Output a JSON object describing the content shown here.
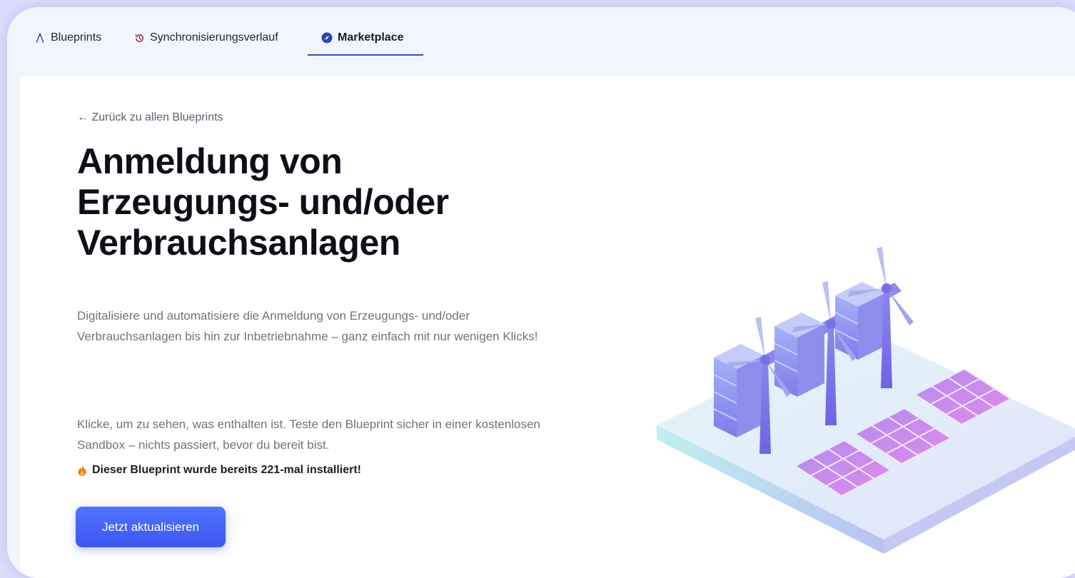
{
  "tabs": [
    {
      "label": "Blueprints",
      "icon": "compass-drafting-icon"
    },
    {
      "label": "Synchronisierungsverlauf",
      "icon": "history-icon"
    },
    {
      "label": "Marketplace",
      "icon": "compass-icon",
      "active": true
    }
  ],
  "back_link": "← Zurück zu allen Blueprints",
  "title": "Anmeldung von Erzeugungs- und/oder Verbrauchsanlagen",
  "description": "Digitalisiere und automatisiere die Anmeldung von Erzeugungs- und/oder Verbrauchsanlagen bis hin zur Inbetriebnahme – ganz einfach mit nur wenigen Klicks!",
  "sandbox_text": "Klicke, um zu sehen, was enthalten ist. Teste den Blueprint sicher in einer kostenlosen Sandbox – nichts passiert, bevor du bereit bist.",
  "install_note": "Dieser Blueprint wurde bereits 221-mal installiert!",
  "cta_label": "Jetzt aktualisieren",
  "colors": {
    "accent": "#3b57ee",
    "tab_active_underline": "#2f4fc8",
    "background": "#dcdcfb"
  }
}
